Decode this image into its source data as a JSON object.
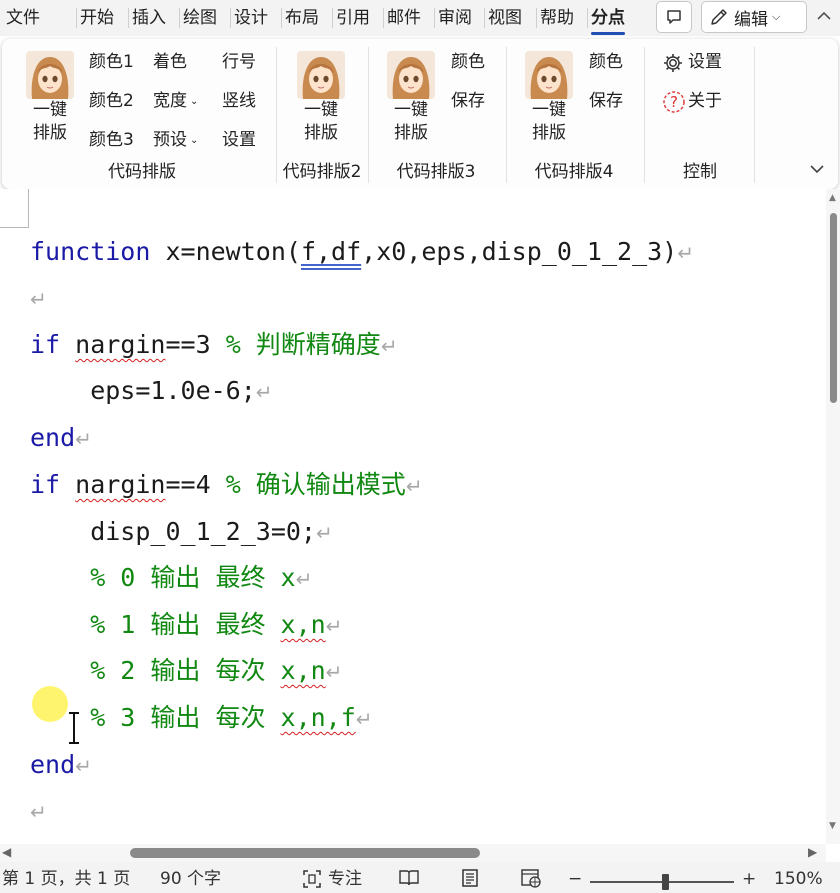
{
  "tabs": [
    {
      "label": "文件",
      "active": false
    },
    {
      "label": "开始",
      "active": false
    },
    {
      "label": "插入",
      "active": false
    },
    {
      "label": "绘图",
      "active": false
    },
    {
      "label": "设计",
      "active": false
    },
    {
      "label": "布局",
      "active": false
    },
    {
      "label": "引用",
      "active": false
    },
    {
      "label": "邮件",
      "active": false
    },
    {
      "label": "审阅",
      "active": false
    },
    {
      "label": "视图",
      "active": false
    },
    {
      "label": "帮助",
      "active": false
    },
    {
      "label": "分点",
      "active": true
    }
  ],
  "header": {
    "comment_icon": "comment-icon",
    "edit_label": "编辑",
    "edit_icon": "pencil-icon"
  },
  "ribbon": {
    "groups": [
      {
        "label": "代码排版",
        "big_button": "一键\n排版",
        "buttons": [
          {
            "label": "颜色1"
          },
          {
            "label": "着色"
          },
          {
            "label": "行号"
          },
          {
            "label": "颜色2"
          },
          {
            "label": "宽度",
            "dropdown": true
          },
          {
            "label": "竖线"
          },
          {
            "label": "颜色3"
          },
          {
            "label": "预设",
            "dropdown": true
          },
          {
            "label": "设置"
          }
        ]
      },
      {
        "label": "代码排版2",
        "big_button": "一键\n排版",
        "buttons": []
      },
      {
        "label": "代码排版3",
        "big_button": "一键\n排版",
        "buttons": [
          {
            "label": "颜色"
          },
          {
            "label": "保存"
          }
        ]
      },
      {
        "label": "代码排版4",
        "big_button": "一键\n排版",
        "buttons": [
          {
            "label": "颜色"
          },
          {
            "label": "保存"
          }
        ]
      },
      {
        "label": "控制",
        "big_button": "",
        "buttons": [
          {
            "label": "设置",
            "icon": "gear-icon"
          },
          {
            "label": "关于",
            "icon": "help-icon"
          }
        ]
      }
    ]
  },
  "code_lines": [
    [
      {
        "t": "function",
        "c": "kw"
      },
      {
        "t": " x=newton("
      },
      {
        "t": "f,df",
        "c": "du"
      },
      {
        "t": ",x0,eps,disp_0_1_2_3)"
      }
    ],
    [],
    [
      {
        "t": "if",
        "c": "kw"
      },
      {
        "t": " "
      },
      {
        "t": "nargin",
        "c": "sq"
      },
      {
        "t": "==3 "
      },
      {
        "t": "% 判断精确度",
        "c": "cm"
      }
    ],
    [
      {
        "t": "    eps=1.0e-6;"
      }
    ],
    [
      {
        "t": "end",
        "c": "kw"
      }
    ],
    [
      {
        "t": "if",
        "c": "kw"
      },
      {
        "t": " "
      },
      {
        "t": "nargin",
        "c": "sq"
      },
      {
        "t": "==4 "
      },
      {
        "t": "% 确认输出模式",
        "c": "cm"
      }
    ],
    [
      {
        "t": "    disp_0_1_2_3=0;"
      }
    ],
    [
      {
        "t": "    % 0 输出 最终 x",
        "c": "cm"
      }
    ],
    [
      {
        "t": "    % 1 输出 最终 ",
        "c": "cm"
      },
      {
        "t": "x,n",
        "c": "cm sq"
      }
    ],
    [
      {
        "t": "    % 2 输出 每次 ",
        "c": "cm"
      },
      {
        "t": "x,n",
        "c": "cm sq"
      }
    ],
    [
      {
        "t": "    % 3 输出 每次 ",
        "c": "cm"
      },
      {
        "t": "x,n,f",
        "c": "cm sq"
      }
    ],
    [
      {
        "t": "end",
        "c": "kw"
      }
    ],
    []
  ],
  "paragraph_mark": "↵",
  "status": {
    "page": "第 1 页，共 1 页",
    "words": "90 个字",
    "focus": "专注",
    "zoom_minus": "−",
    "zoom_plus": "+",
    "zoom": "150%",
    "zoom_fraction": 0.52
  }
}
